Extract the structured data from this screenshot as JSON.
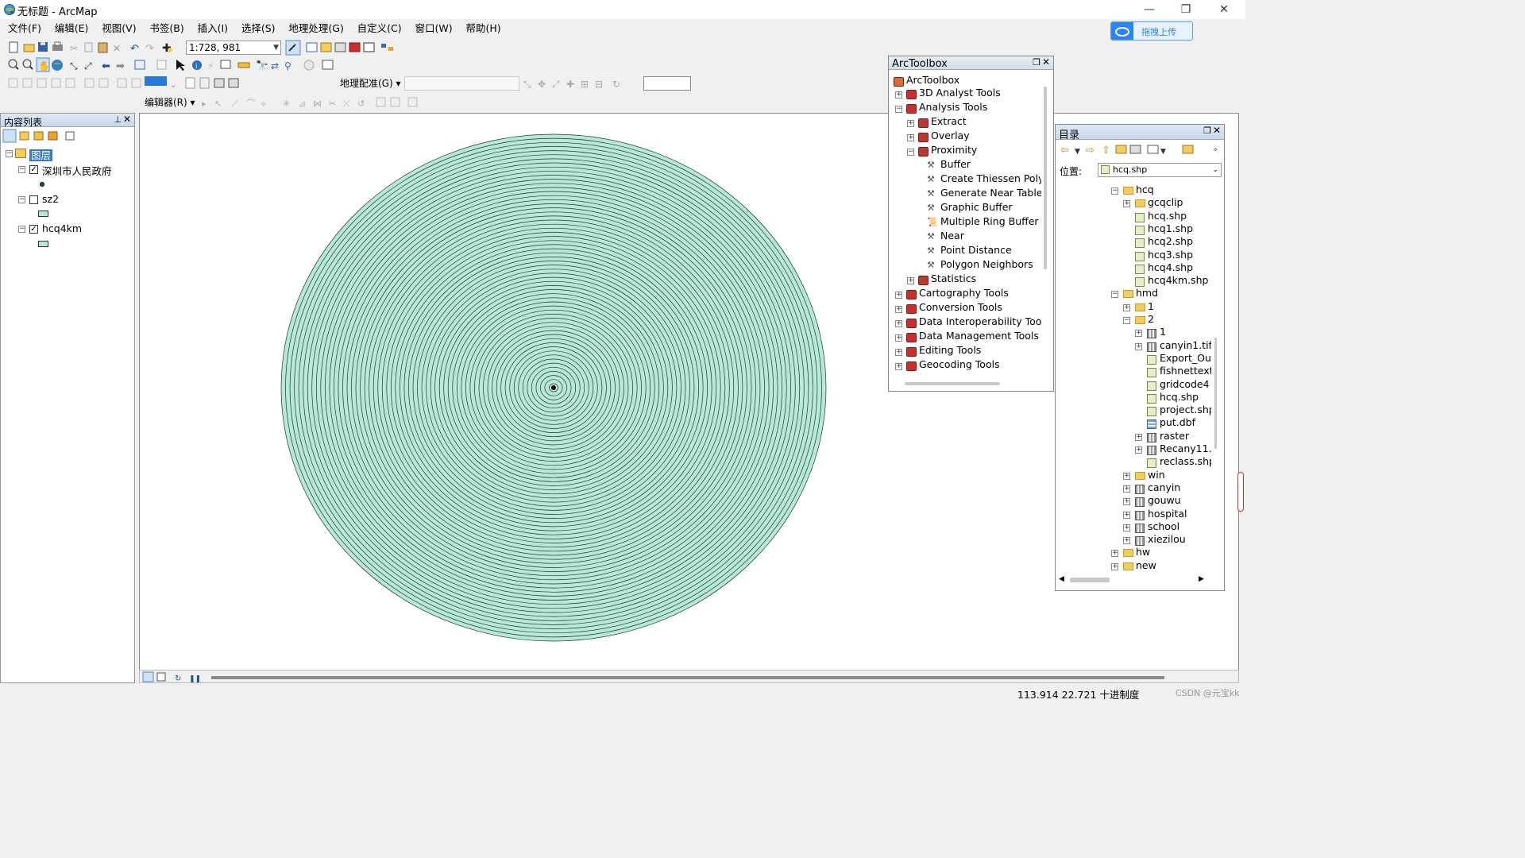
{
  "window": {
    "title": "无标题 - ArcMap",
    "minimize": "—",
    "maximize": "❐",
    "close": "✕"
  },
  "menu": [
    "文件(F)",
    "编辑(E)",
    "视图(V)",
    "书签(B)",
    "插入(I)",
    "选择(S)",
    "地理处理(G)",
    "自定义(C)",
    "窗口(W)",
    "帮助(H)"
  ],
  "upload_button": "拖拽上传",
  "toolbar": {
    "scale": "1:728, 981",
    "georeferencing_label": "地理配准(G) ▾",
    "editor_label": "编辑器(R) ▾"
  },
  "toc": {
    "title": "内容列表",
    "root": "图层",
    "layers": [
      {
        "name": "深圳市人民政府",
        "checked": true,
        "expander": "−"
      },
      {
        "name": "sz2",
        "checked": false,
        "expander": "−"
      },
      {
        "name": "hcq4km",
        "checked": true,
        "expander": "−"
      }
    ]
  },
  "arctoolbox": {
    "title": "ArcToolbox",
    "root": "ArcToolbox",
    "items": [
      {
        "label": "3D Analyst Tools",
        "level": 0,
        "kind": "toolbox",
        "exp": "+"
      },
      {
        "label": "Analysis Tools",
        "level": 0,
        "kind": "toolbox",
        "exp": "−"
      },
      {
        "label": "Extract",
        "level": 1,
        "kind": "toolset",
        "exp": "+"
      },
      {
        "label": "Overlay",
        "level": 1,
        "kind": "toolset",
        "exp": "+"
      },
      {
        "label": "Proximity",
        "level": 1,
        "kind": "toolset",
        "exp": "−"
      },
      {
        "label": "Buffer",
        "level": 2,
        "kind": "tool"
      },
      {
        "label": "Create Thiessen Polygons",
        "level": 2,
        "kind": "tool"
      },
      {
        "label": "Generate Near Table",
        "level": 2,
        "kind": "tool"
      },
      {
        "label": "Graphic Buffer",
        "level": 2,
        "kind": "tool"
      },
      {
        "label": "Multiple Ring Buffer",
        "level": 2,
        "kind": "script"
      },
      {
        "label": "Near",
        "level": 2,
        "kind": "tool"
      },
      {
        "label": "Point Distance",
        "level": 2,
        "kind": "tool"
      },
      {
        "label": "Polygon Neighbors",
        "level": 2,
        "kind": "tool"
      },
      {
        "label": "Statistics",
        "level": 1,
        "kind": "toolset",
        "exp": "+"
      },
      {
        "label": "Cartography Tools",
        "level": 0,
        "kind": "toolbox",
        "exp": "+"
      },
      {
        "label": "Conversion Tools",
        "level": 0,
        "kind": "toolbox",
        "exp": "+"
      },
      {
        "label": "Data Interoperability Tools",
        "level": 0,
        "kind": "toolbox",
        "exp": "+"
      },
      {
        "label": "Data Management Tools",
        "level": 0,
        "kind": "toolbox",
        "exp": "+"
      },
      {
        "label": "Editing Tools",
        "level": 0,
        "kind": "toolbox",
        "exp": "+"
      },
      {
        "label": "Geocoding Tools",
        "level": 0,
        "kind": "toolbox",
        "exp": "+"
      }
    ]
  },
  "catalog": {
    "title": "目录",
    "location_label": "位置:",
    "location_value": "hcq.shp",
    "items": [
      {
        "label": "hcq",
        "level": 0,
        "kind": "folder",
        "exp": "−"
      },
      {
        "label": "gcqclip",
        "level": 1,
        "kind": "folder",
        "exp": "+"
      },
      {
        "label": "hcq.shp",
        "level": 1,
        "kind": "shp"
      },
      {
        "label": "hcq1.shp",
        "level": 1,
        "kind": "shp"
      },
      {
        "label": "hcq2.shp",
        "level": 1,
        "kind": "shp"
      },
      {
        "label": "hcq3.shp",
        "level": 1,
        "kind": "shp"
      },
      {
        "label": "hcq4.shp",
        "level": 1,
        "kind": "shp"
      },
      {
        "label": "hcq4km.shp",
        "level": 1,
        "kind": "shp"
      },
      {
        "label": "hmd",
        "level": 0,
        "kind": "folder",
        "exp": "−"
      },
      {
        "label": "1",
        "level": 1,
        "kind": "folder",
        "exp": "+"
      },
      {
        "label": "2",
        "level": 1,
        "kind": "folder",
        "exp": "−"
      },
      {
        "label": "1",
        "level": 2,
        "kind": "grid",
        "exp": "+"
      },
      {
        "label": "canyin1.tif",
        "level": 2,
        "kind": "grid",
        "exp": "+"
      },
      {
        "label": "Export_Output",
        "level": 2,
        "kind": "shp"
      },
      {
        "label": "fishnettext",
        "level": 2,
        "kind": "shp"
      },
      {
        "label": "gridcode4",
        "level": 2,
        "kind": "shp"
      },
      {
        "label": "hcq.shp",
        "level": 2,
        "kind": "shp"
      },
      {
        "label": "project.shp",
        "level": 2,
        "kind": "shp"
      },
      {
        "label": "put.dbf",
        "level": 2,
        "kind": "dbf"
      },
      {
        "label": "raster",
        "level": 2,
        "kind": "grid",
        "exp": "+"
      },
      {
        "label": "Recany11.",
        "level": 2,
        "kind": "grid",
        "exp": "+"
      },
      {
        "label": "reclass.shp",
        "level": 2,
        "kind": "shp"
      },
      {
        "label": "win",
        "level": 1,
        "kind": "folder",
        "exp": "+"
      },
      {
        "label": "canyin",
        "level": 1,
        "kind": "grid",
        "exp": "+"
      },
      {
        "label": "gouwu",
        "level": 1,
        "kind": "grid",
        "exp": "+"
      },
      {
        "label": "hospital",
        "level": 1,
        "kind": "grid",
        "exp": "+"
      },
      {
        "label": "school",
        "level": 1,
        "kind": "grid",
        "exp": "+"
      },
      {
        "label": "xiezilou",
        "level": 1,
        "kind": "grid",
        "exp": "+"
      },
      {
        "label": "hw",
        "level": 0,
        "kind": "folder",
        "exp": "+"
      },
      {
        "label": "new",
        "level": 0,
        "kind": "folder",
        "exp": "+"
      }
    ]
  },
  "status": {
    "coords": "113.914  22.721 十进制度",
    "watermark": "CSDN @元宝kk"
  },
  "colors": {
    "ring_fill": "#b8e8d8",
    "ring_stroke": "#1a3a2a",
    "accent": "#3379d0",
    "toolbox_red": "#c9302c"
  }
}
